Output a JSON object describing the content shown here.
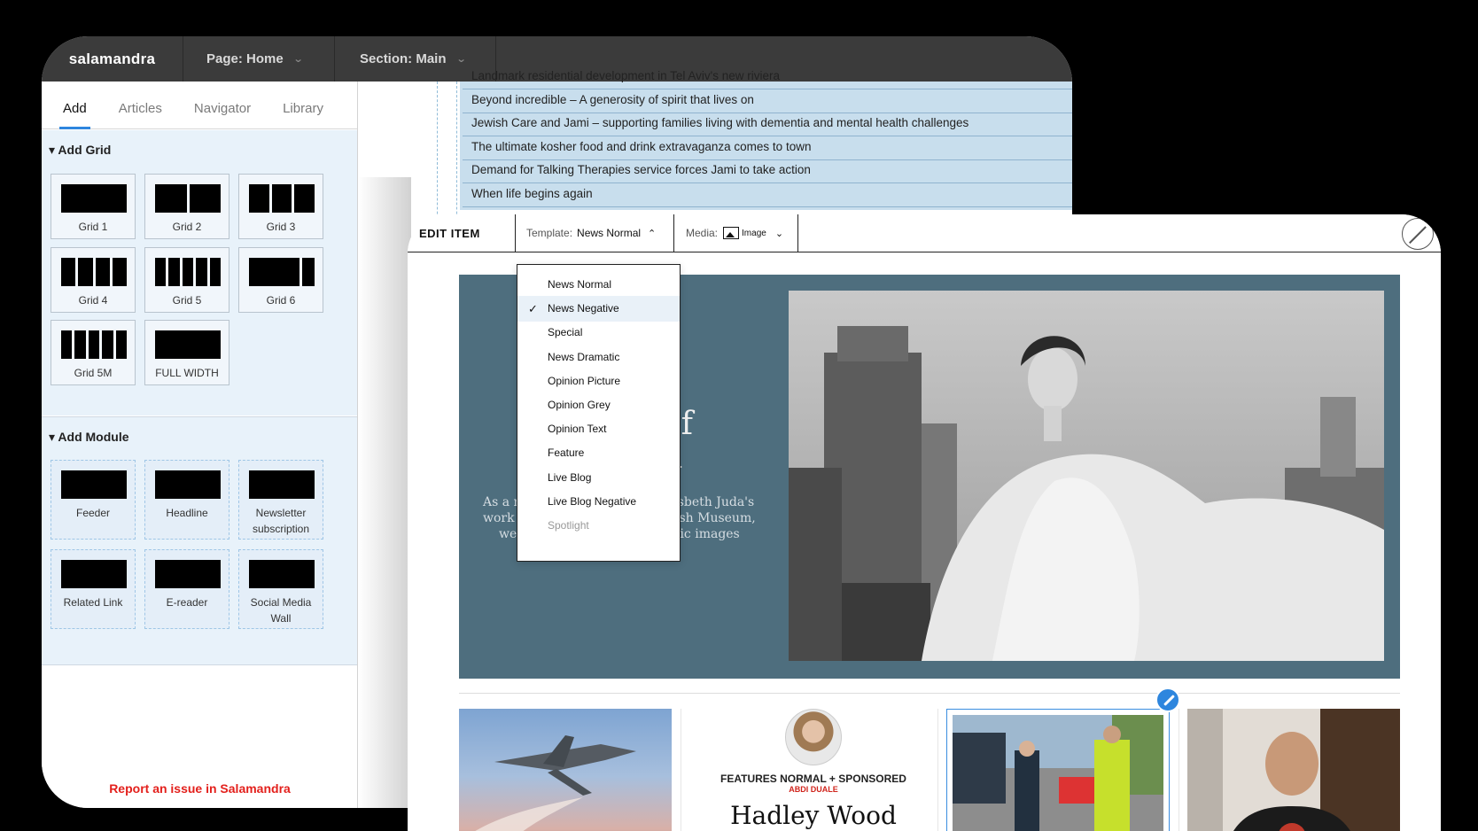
{
  "app": {
    "brand": "salamandra",
    "page_selector": "Page: Home",
    "section_selector": "Section: Main"
  },
  "sidebar": {
    "tabs": [
      {
        "label": "Add",
        "active": true
      },
      {
        "label": "Articles",
        "active": false
      },
      {
        "label": "Navigator",
        "active": false
      },
      {
        "label": "Library",
        "active": false
      }
    ],
    "add_grid": {
      "title": "Add Grid",
      "items": [
        {
          "label": "Grid 1",
          "cols": 1
        },
        {
          "label": "Grid 2",
          "cols": 2
        },
        {
          "label": "Grid 3",
          "cols": 3
        },
        {
          "label": "Grid 4",
          "cols": 4
        },
        {
          "label": "Grid 5",
          "cols": 5
        },
        {
          "label": "Grid 6",
          "cols": 2
        },
        {
          "label": "Grid 5M",
          "cols": 5
        },
        {
          "label": "FULL WIDTH",
          "cols": 1
        }
      ]
    },
    "add_module": {
      "title": "Add Module",
      "items": [
        {
          "label": "Feeder"
        },
        {
          "label": "Headline"
        },
        {
          "label": "Newsletter subscription"
        },
        {
          "label": "Related Link"
        },
        {
          "label": "E-reader"
        },
        {
          "label": "Social Media Wall"
        }
      ]
    },
    "report_link": "Report an issue in Salamandra"
  },
  "article_list": [
    "Landmark residential development in Tel Aviv's new riviera",
    "Beyond incredible – A generosity of spirit that lives on",
    "Jewish Care and Jami – supporting families living with dementia and mental health challenges",
    "The ultimate kosher food and drink extravaganza comes to town",
    "Demand for Talking Therapies service forces Jami to take action",
    "When life begins again"
  ],
  "edit_item": {
    "title": "EDIT ITEM",
    "template_label": "Template:",
    "template_value": "News Normal",
    "media_label": "Media:",
    "media_value": "Image",
    "template_options": [
      {
        "label": "News Normal",
        "selected": false,
        "disabled": false
      },
      {
        "label": "News Negative",
        "selected": true,
        "disabled": false
      },
      {
        "label": "Special",
        "selected": false,
        "disabled": false
      },
      {
        "label": "News Dramatic",
        "selected": false,
        "disabled": false
      },
      {
        "label": "Opinion Picture",
        "selected": false,
        "disabled": false
      },
      {
        "label": "Opinion Grey",
        "selected": false,
        "disabled": false
      },
      {
        "label": "Opinion Text",
        "selected": false,
        "disabled": false
      },
      {
        "label": "Feature",
        "selected": false,
        "disabled": false
      },
      {
        "label": "Live Blog",
        "selected": false,
        "disabled": false
      },
      {
        "label": "Live Blog Negative",
        "selected": false,
        "disabled": false
      },
      {
        "label": "Spotlight",
        "selected": false,
        "disabled": true
      }
    ]
  },
  "hero": {
    "title_fragments": [
      "of",
      "n"
    ],
    "subtitle_left": [
      "As a r",
      "work g",
      "we"
    ],
    "subtitle_right": [
      "Elsbeth Juda's",
      "wish Museum,",
      "onic images"
    ]
  },
  "cards": {
    "kicker": "FEATURES NORMAL + SPONSORED",
    "byline": "ABDI DUALE",
    "headline": "Hadley Wood"
  },
  "colors": {
    "accent": "#2e86de",
    "hero_bg": "#4e6e7e",
    "report": "#e3201c",
    "topbar": "#3b3b3b"
  }
}
